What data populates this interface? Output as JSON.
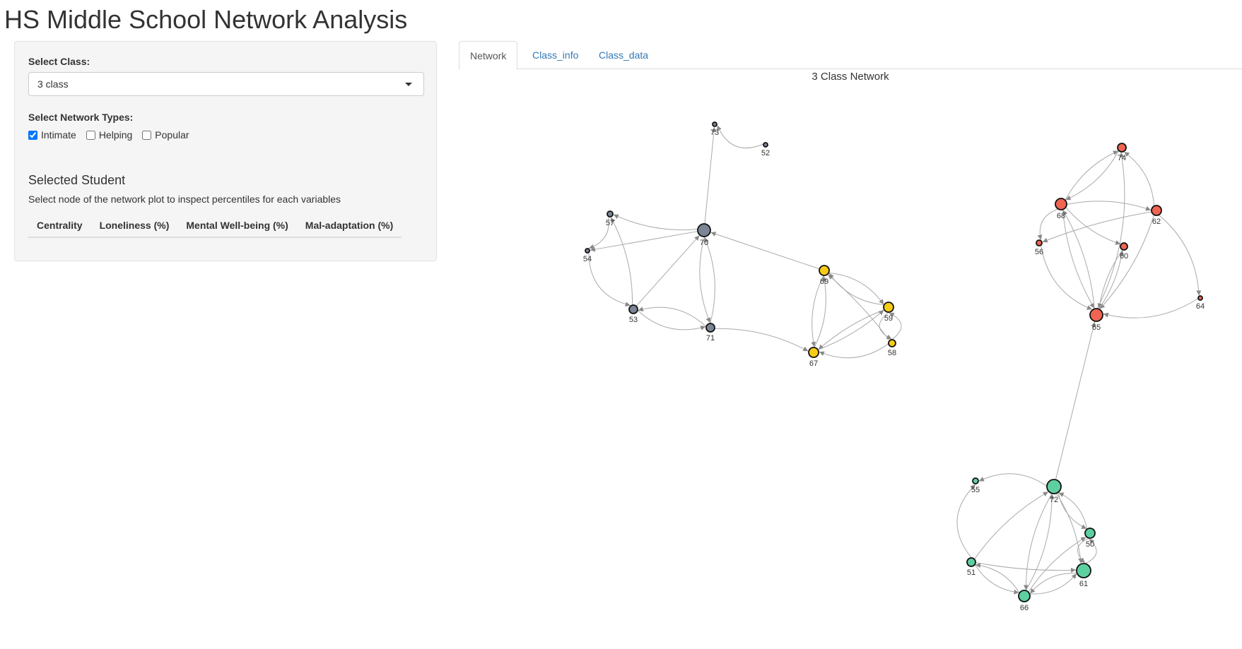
{
  "app_title": "HS Middle School Network Analysis",
  "sidebar": {
    "class_label": "Select Class:",
    "class_value": "3 class",
    "network_types_label": "Select Network Types:",
    "network_types": [
      {
        "label": "Intimate",
        "checked": true
      },
      {
        "label": "Helping",
        "checked": false
      },
      {
        "label": "Popular",
        "checked": false
      }
    ],
    "selected_title": "Selected Student",
    "selected_help": "Select node of the network plot to inspect percentiles for each variables",
    "table_headers": [
      "Centrality",
      "Loneliness (%)",
      "Mental Well-being (%)",
      "Mal-adaptation (%)"
    ]
  },
  "tabs": [
    {
      "label": "Network",
      "active": true
    },
    {
      "label": "Class_info",
      "active": false
    },
    {
      "label": "Class_data",
      "active": false
    }
  ],
  "network": {
    "title": "3 Class Network",
    "colors": {
      "group_gray": "#7b8595",
      "group_yellow": "#f7cc17",
      "group_red": "#f06451",
      "group_green": "#5ecfa0",
      "edge": "#aaaaaa",
      "arrow": "#888888"
    },
    "nodes": [
      {
        "id": "73",
        "label": "73",
        "group": "gray"
      },
      {
        "id": "52",
        "label": "52",
        "group": "gray"
      },
      {
        "id": "57",
        "label": "57",
        "group": "gray"
      },
      {
        "id": "70",
        "label": "70",
        "group": "gray"
      },
      {
        "id": "54",
        "label": "54",
        "group": "gray"
      },
      {
        "id": "53",
        "label": "53",
        "group": "gray"
      },
      {
        "id": "71",
        "label": "71",
        "group": "gray"
      },
      {
        "id": "69",
        "label": "69",
        "group": "yellow"
      },
      {
        "id": "59",
        "label": "59",
        "group": "yellow"
      },
      {
        "id": "58",
        "label": "58",
        "group": "yellow"
      },
      {
        "id": "67",
        "label": "67",
        "group": "yellow"
      },
      {
        "id": "74",
        "label": "74",
        "group": "red"
      },
      {
        "id": "68",
        "label": "68",
        "group": "red"
      },
      {
        "id": "62",
        "label": "62",
        "group": "red"
      },
      {
        "id": "56",
        "label": "56",
        "group": "red"
      },
      {
        "id": "60",
        "label": "60",
        "group": "red"
      },
      {
        "id": "64",
        "label": "64",
        "group": "red"
      },
      {
        "id": "65",
        "label": "65",
        "group": "red"
      },
      {
        "id": "55",
        "label": "55",
        "group": "green"
      },
      {
        "id": "72",
        "label": "72",
        "group": "green"
      },
      {
        "id": "50",
        "label": "50",
        "group": "green"
      },
      {
        "id": "51",
        "label": "51",
        "group": "green"
      },
      {
        "id": "61",
        "label": "61",
        "group": "green"
      },
      {
        "id": "66",
        "label": "66",
        "group": "green"
      }
    ],
    "edges": [
      [
        "52",
        "73"
      ],
      [
        "70",
        "73"
      ],
      [
        "70",
        "57"
      ],
      [
        "70",
        "54"
      ],
      [
        "53",
        "70"
      ],
      [
        "70",
        "71"
      ],
      [
        "71",
        "70"
      ],
      [
        "71",
        "53"
      ],
      [
        "53",
        "71"
      ],
      [
        "57",
        "54"
      ],
      [
        "54",
        "53"
      ],
      [
        "53",
        "57"
      ],
      [
        "69",
        "70"
      ],
      [
        "71",
        "67"
      ],
      [
        "67",
        "69"
      ],
      [
        "69",
        "67"
      ],
      [
        "69",
        "59"
      ],
      [
        "59",
        "69"
      ],
      [
        "58",
        "69"
      ],
      [
        "59",
        "67"
      ],
      [
        "67",
        "59"
      ],
      [
        "58",
        "67"
      ],
      [
        "59",
        "58"
      ],
      [
        "58",
        "59"
      ],
      [
        "68",
        "74"
      ],
      [
        "74",
        "68"
      ],
      [
        "62",
        "74"
      ],
      [
        "65",
        "74"
      ],
      [
        "68",
        "62"
      ],
      [
        "68",
        "60"
      ],
      [
        "68",
        "56"
      ],
      [
        "62",
        "56"
      ],
      [
        "68",
        "65"
      ],
      [
        "56",
        "65"
      ],
      [
        "62",
        "65"
      ],
      [
        "64",
        "65"
      ],
      [
        "60",
        "65"
      ],
      [
        "65",
        "60"
      ],
      [
        "62",
        "64"
      ],
      [
        "65",
        "68"
      ],
      [
        "72",
        "65"
      ],
      [
        "72",
        "55"
      ],
      [
        "51",
        "55"
      ],
      [
        "51",
        "72"
      ],
      [
        "72",
        "50"
      ],
      [
        "50",
        "72"
      ],
      [
        "72",
        "61"
      ],
      [
        "72",
        "66"
      ],
      [
        "66",
        "72"
      ],
      [
        "50",
        "61"
      ],
      [
        "61",
        "50"
      ],
      [
        "51",
        "61"
      ],
      [
        "51",
        "66"
      ],
      [
        "66",
        "51"
      ],
      [
        "66",
        "61"
      ],
      [
        "61",
        "66"
      ],
      [
        "66",
        "50"
      ]
    ]
  }
}
